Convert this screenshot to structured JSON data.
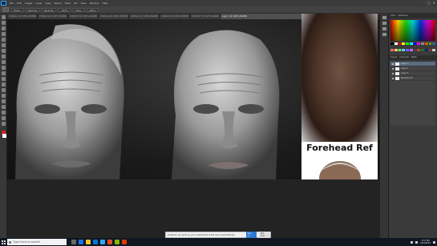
{
  "menubar": {
    "items": [
      "File",
      "Edit",
      "Image",
      "Layer",
      "Type",
      "Select",
      "Filter",
      "3D",
      "View",
      "Window",
      "Help"
    ],
    "window_controls": [
      "–",
      "□",
      "✕"
    ]
  },
  "options_bar": {
    "fields": [
      "Mode:",
      "Normal",
      "Opacity:",
      "100%",
      "Flow:",
      "100%"
    ]
  },
  "document_tabs": [
    {
      "title": "Untitled-1 @ 100% (RGB/8)",
      "active": false
    },
    {
      "title": "Untitled-2 @ 100% (RGB/8)",
      "active": false
    },
    {
      "title": "Untitled-3 @ 100% (RGB/8)",
      "active": false
    },
    {
      "title": "Untitled-4 @ 100% (RGB/8)",
      "active": false
    },
    {
      "title": "Untitled-5 @ 100% (RGB/8)",
      "active": false
    },
    {
      "title": "Untitled-6 @ 100% (RGB/8)",
      "active": false
    },
    {
      "title": "Untitled-7 @ 100% (RGB/8)",
      "active": false
    },
    {
      "title": "Layer 1 @ 100% (RGB/8)",
      "active": true
    }
  ],
  "reference": {
    "caption": "Forehead Ref"
  },
  "panels": {
    "tabs": [
      "Color",
      "Swatches"
    ],
    "layers_tabs": [
      "Layers",
      "Channels",
      "Paths"
    ],
    "layers": [
      {
        "name": "Layer 1",
        "selected": true
      },
      {
        "name": "Layer 2",
        "selected": false
      },
      {
        "name": "Layer 3",
        "selected": false
      },
      {
        "name": "Background",
        "selected": false
      }
    ]
  },
  "notification": {
    "text": "OneDrive can back up your screenshots to the cloud automatically.",
    "primary": "Turn on",
    "secondary": "Not now"
  },
  "taskbar": {
    "search_placeholder": "Type here to search",
    "time": "3:57 PM",
    "date": "5/24/2019"
  },
  "colors": {
    "foreground": "#d0271c",
    "background": "#ffffff",
    "accent": "#2b78d1"
  }
}
